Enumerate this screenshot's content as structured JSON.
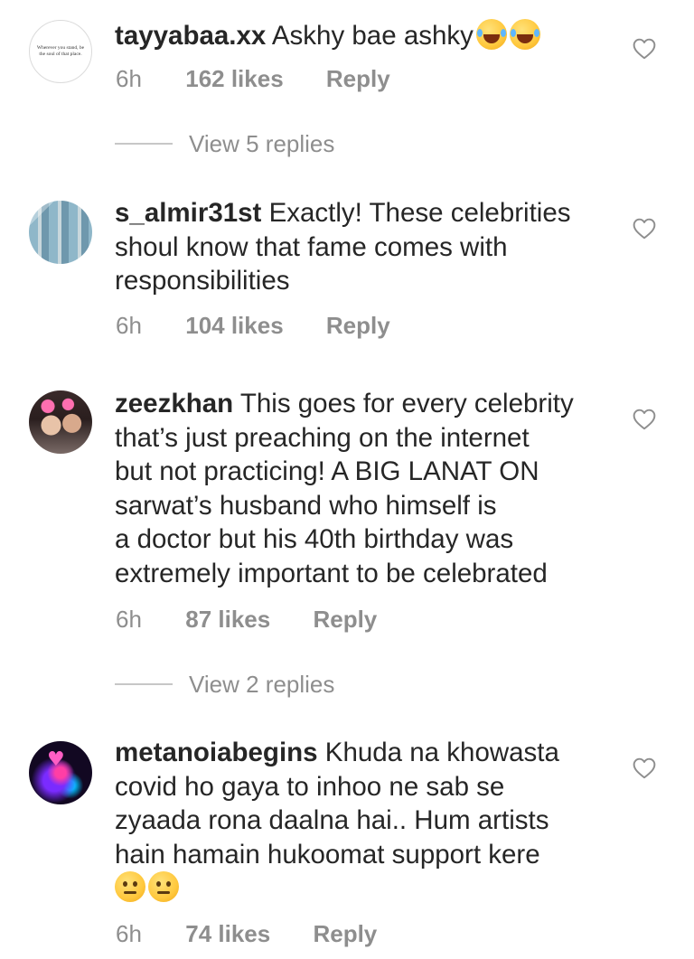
{
  "comments": [
    {
      "avatar_icon": "quote-avatar",
      "avatar_text": "Wherever you stand, be the soul of that place.",
      "username": "tayyabaa.xx",
      "text_lines": [
        "Askhy bae ashky"
      ],
      "emoji": [
        "face-with-tears-of-joy",
        "face-with-tears-of-joy"
      ],
      "time": "6h",
      "likes": "162 likes",
      "reply": "Reply",
      "view_replies": "View 5 replies"
    },
    {
      "avatar_icon": "photo-avatar",
      "username": "s_almir31st",
      "text_lines": [
        "Exactly! These celebrities",
        "shoul know that fame comes with",
        "responsibilities"
      ],
      "time": "6h",
      "likes": "104 likes",
      "reply": "Reply"
    },
    {
      "avatar_icon": "photo-avatar",
      "username": "zeezkhan",
      "text_lines": [
        "This goes for every celebrity",
        "that’s just preaching on the internet",
        "but not practicing! A BIG LANAT ON",
        "sarwat’s husband who himself is",
        "a doctor but his 40th birthday was",
        "extremely important to be celebrated"
      ],
      "time": "6h",
      "likes": "87 likes",
      "reply": "Reply",
      "view_replies": "View 2 replies"
    },
    {
      "avatar_icon": "neon-heart-hand-avatar",
      "username": "metanoiabegins",
      "text_lines": [
        "Khuda na khowasta",
        "covid ho gaya to inhoo ne sab se",
        "zyaada rona daalna hai.. Hum artists",
        "hain hamain hukoomat support kere"
      ],
      "emoji": [
        "neutral-face",
        "neutral-face"
      ],
      "time": "6h",
      "likes": "74 likes",
      "reply": "Reply"
    }
  ],
  "colors": {
    "text": "#262626",
    "secondary": "#8e8e8e",
    "divider": "#c7c7c7"
  }
}
